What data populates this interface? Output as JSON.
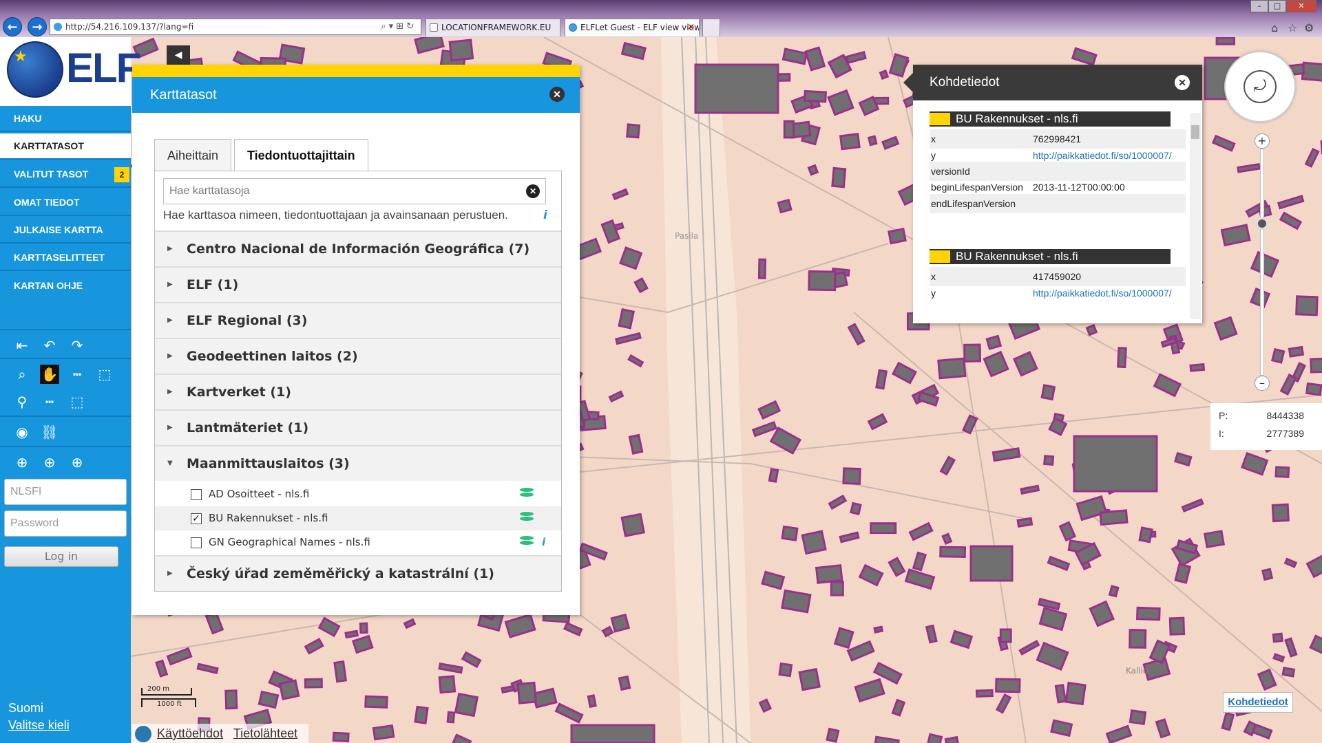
{
  "browser": {
    "url": "http://54.216.109.137/?lang=fi",
    "tabs": [
      {
        "label": "LOCATIONFRAMEWORK.EU"
      },
      {
        "label": "ELFLet Guest - ELF view view"
      }
    ],
    "tab_close": "×"
  },
  "logo": {
    "text": "ELF"
  },
  "sidebar": {
    "items": [
      {
        "label": "HAKU"
      },
      {
        "label": "KARTTATASOT"
      },
      {
        "label": "VALITUT TASOT",
        "badge": "2"
      },
      {
        "label": "OMAT TIEDOT"
      },
      {
        "label": "JULKAISE KARTTA"
      },
      {
        "label": "KARTTASELITTEET"
      },
      {
        "label": "KARTAN OHJE"
      }
    ],
    "username_placeholder": "NLSFI",
    "password_placeholder": "Password",
    "login_label": "Log in",
    "language": "Suomi",
    "change_language": "Valitse kieli"
  },
  "panel": {
    "title": "Karttatasot",
    "tabs": [
      {
        "label": "Aiheittain"
      },
      {
        "label": "Tiedontuottajittain"
      }
    ],
    "search_placeholder": "Hae karttatasoja",
    "search_hint": "Hae karttasoa nimeen, tiedontuottajaan ja avainsanaan perustuen.",
    "groups": [
      {
        "label": "Centro Nacional de Información Geográfica (7)"
      },
      {
        "label": "ELF (1)"
      },
      {
        "label": "ELF Regional (3)"
      },
      {
        "label": "Geodeettinen laitos (2)"
      },
      {
        "label": "Kartverket (1)"
      },
      {
        "label": "Lantmäteriet (1)"
      },
      {
        "label": "Maanmittauslaitos (3)"
      },
      {
        "label": "Český úřad zeměměřický a katastrální (1)"
      }
    ],
    "layers": [
      {
        "label": "AD Osoitteet - nls.fi",
        "checked": false
      },
      {
        "label": "BU Rakennukset - nls.fi",
        "checked": true
      },
      {
        "label": "GN Geographical Names - nls.fi",
        "checked": false
      }
    ],
    "check_mark": "✓"
  },
  "feature_info": {
    "title": "Kohdetiedot",
    "sections": [
      {
        "layer": "BU Rakennukset - nls.fi",
        "rows": [
          {
            "key": "x",
            "value": "762998421"
          },
          {
            "key": "y",
            "value": "http://paikkatiedot.fi/so/1000007/"
          },
          {
            "key": "versionId",
            "value": ""
          },
          {
            "key": "beginLifespanVersion",
            "value": "2013-11-12T00:00:00"
          },
          {
            "key": "endLifespanVersion",
            "value": ""
          }
        ]
      },
      {
        "layer": "BU Rakennukset - nls.fi",
        "rows": [
          {
            "key": "x",
            "value": "417459020"
          },
          {
            "key": "y",
            "value": "http://paikkatiedot.fi/so/1000007/"
          }
        ]
      }
    ]
  },
  "coords": {
    "p_label": "P:",
    "p_value": "8444338",
    "i_label": "I:",
    "i_value": "2777389"
  },
  "scale": {
    "metric": "200 m",
    "imperial": "1000 ft"
  },
  "footer": {
    "terms": "Käyttöehdot",
    "sources": "Tietolähteet"
  },
  "map_labels": {
    "kallio": "Kallio",
    "pasila": "Pasila"
  },
  "fi_button": "Kohdetiedot",
  "colors": {
    "sidebar": "#1796de",
    "accent": "#ffd400",
    "map_bg": "#f3d8c8",
    "building_fill": "#707070",
    "building_outline": "#9c2f8e"
  }
}
